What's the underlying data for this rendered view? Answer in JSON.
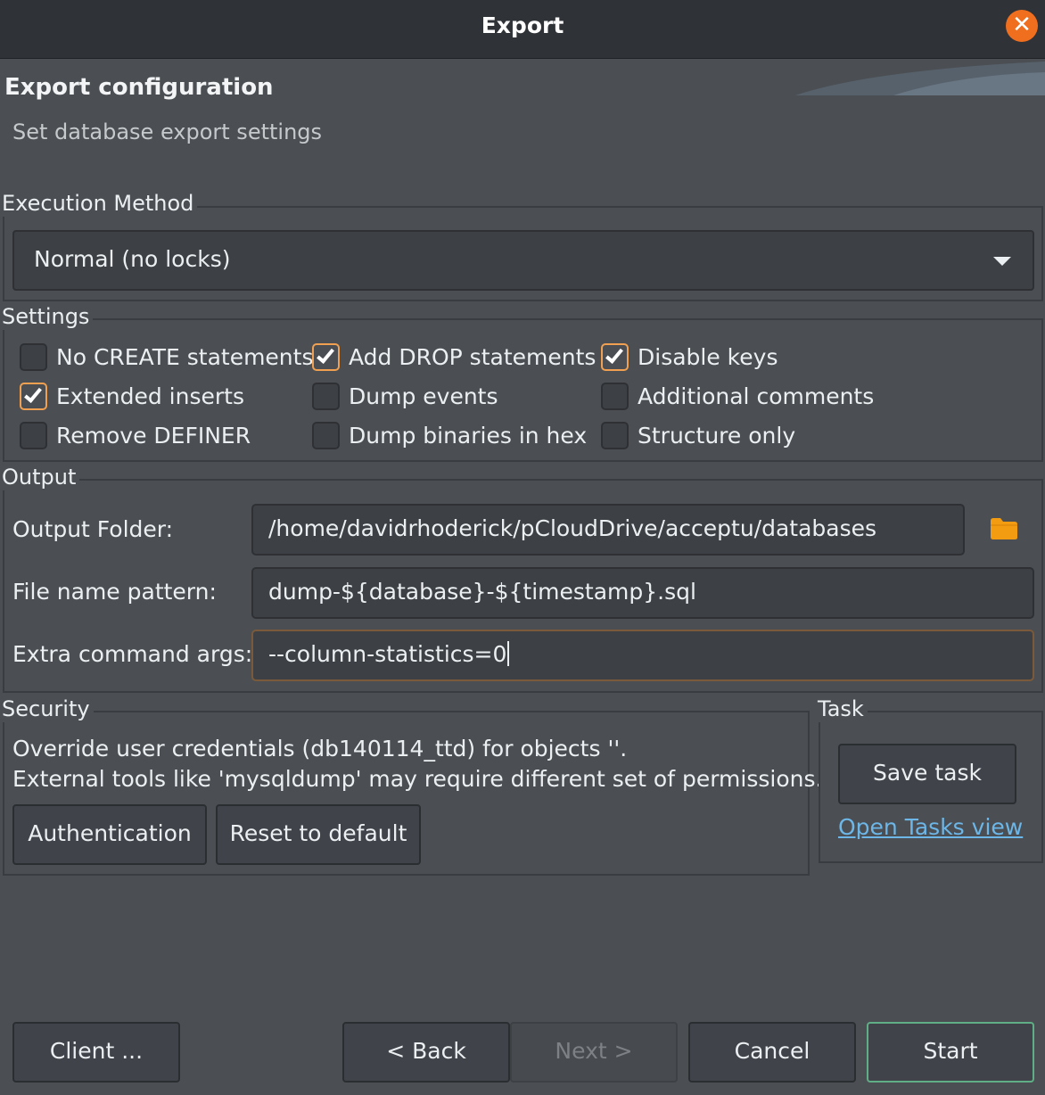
{
  "window": {
    "title": "Export"
  },
  "header": {
    "title": "Export configuration",
    "subtitle": "Set database export settings"
  },
  "execution": {
    "label": "Execution Method",
    "selected": "Normal (no locks)"
  },
  "settings": {
    "label": "Settings",
    "options": [
      {
        "label": "No CREATE statements",
        "checked": false
      },
      {
        "label": "Add DROP statements",
        "checked": true
      },
      {
        "label": "Disable keys",
        "checked": true
      },
      {
        "label": "Extended inserts",
        "checked": true
      },
      {
        "label": "Dump events",
        "checked": false
      },
      {
        "label": "Additional comments",
        "checked": false
      },
      {
        "label": "Remove DEFINER",
        "checked": false
      },
      {
        "label": "Dump binaries in hex",
        "checked": false
      },
      {
        "label": "Structure only",
        "checked": false
      }
    ]
  },
  "output": {
    "label": "Output",
    "folder_label": "Output Folder:",
    "folder_value": "/home/davidrhoderick/pCloudDrive/acceptu/databases",
    "pattern_label": "File name pattern:",
    "pattern_value": "dump-${database}-${timestamp}.sql",
    "args_label": "Extra command args:",
    "args_value": "--column-statistics=0"
  },
  "security": {
    "label": "Security",
    "line1": "Override user credentials (db140114_ttd) for objects ''.",
    "line2": "External tools like 'mysqldump' may require different set of permissions.",
    "auth_button": "Authentication",
    "reset_button": "Reset to default"
  },
  "task": {
    "label": "Task",
    "save_button": "Save task",
    "open_link": "Open Tasks view"
  },
  "footer": {
    "client_button": "Client ...",
    "back_button": "< Back",
    "next_button": "Next >",
    "cancel_button": "Cancel",
    "start_button": "Start"
  },
  "colors": {
    "accent": "#f06f1e",
    "checkbox_border_checked": "#f0a050",
    "link": "#6cb6e8",
    "default_button_border": "#5fae85"
  }
}
